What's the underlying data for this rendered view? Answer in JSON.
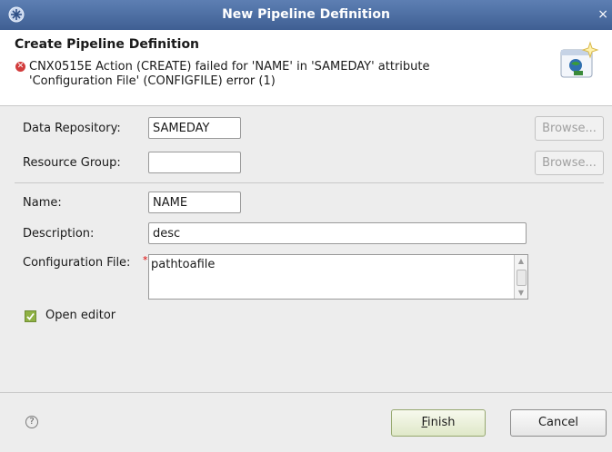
{
  "window": {
    "title": "New Pipeline Definition",
    "close_glyph": "×"
  },
  "header": {
    "title": "Create Pipeline Definition",
    "error_glyph": "✕",
    "message": "CNX0515E Action (CREATE) failed for 'NAME' in 'SAMEDAY' attribute 'Configuration File' (CONFIGFILE) error (1)"
  },
  "form": {
    "data_repository": {
      "label": "Data Repository:",
      "value": "SAMEDAY",
      "browse_label": "Browse..."
    },
    "resource_group": {
      "label": "Resource Group:",
      "value": "",
      "browse_label": "Browse..."
    },
    "name": {
      "label": "Name:",
      "value": "NAME"
    },
    "description": {
      "label": "Description:",
      "value": "desc"
    },
    "configuration_file": {
      "label": "Configuration File:",
      "value": "pathtoafile",
      "required_marker": "*"
    },
    "open_editor": {
      "label": "Open editor",
      "checked": true
    }
  },
  "footer": {
    "help_glyph": "?",
    "finish_mnemonic": "F",
    "finish_rest": "inish",
    "cancel_label": "Cancel"
  },
  "colors": {
    "title_bar": "#4b6ca3",
    "error": "#d23c3c",
    "checkbox": "#8fb144"
  }
}
